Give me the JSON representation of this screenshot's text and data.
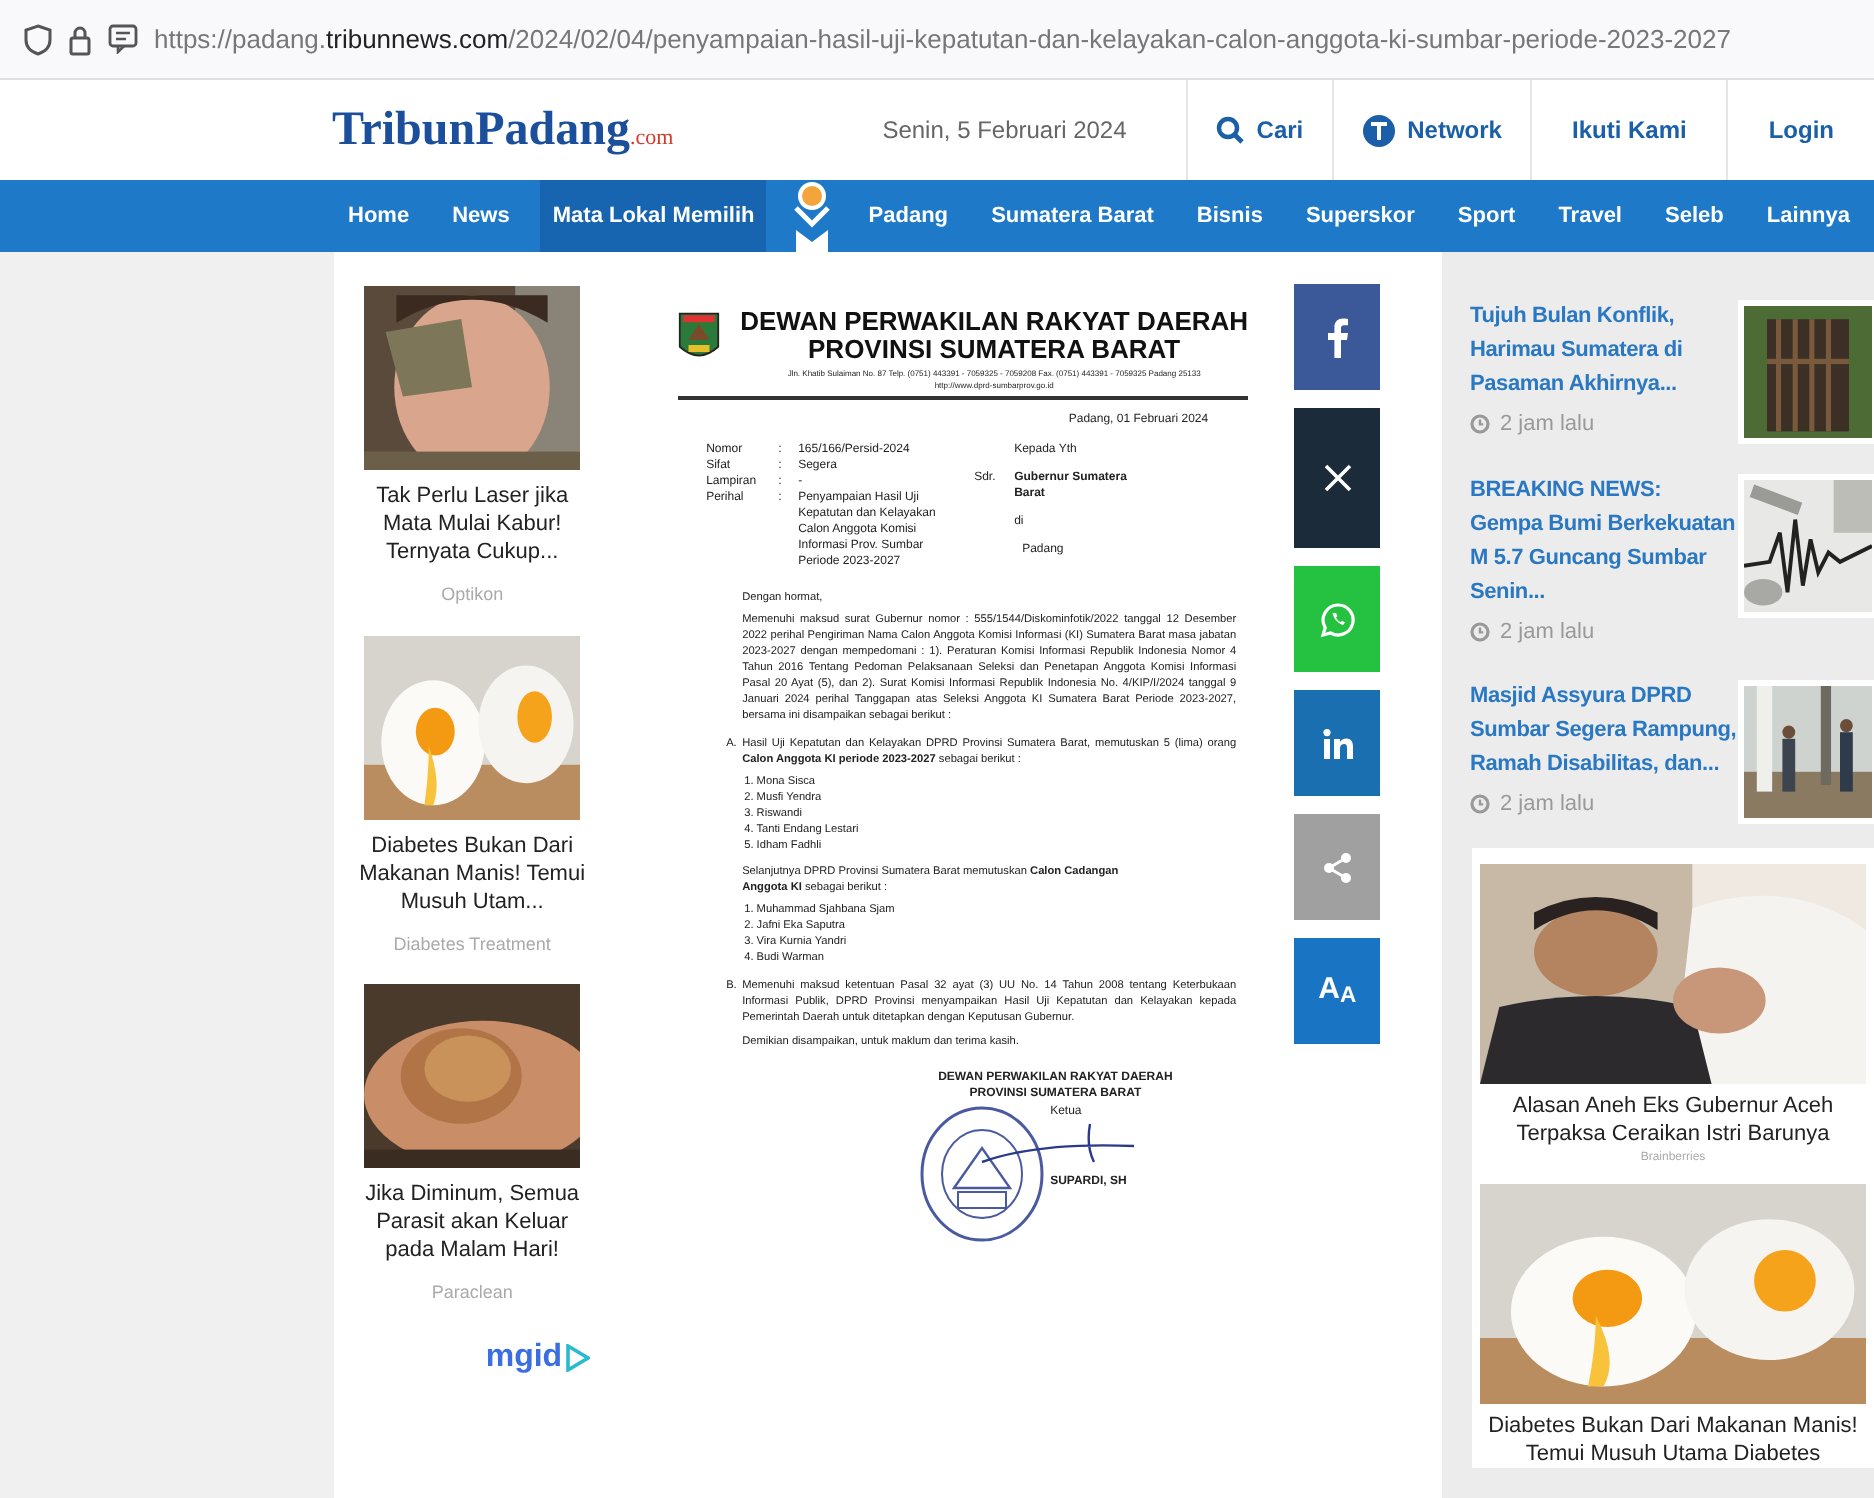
{
  "browser": {
    "url": "https://padang.**tribunnews.com**/2024/02/04/penyampaian-hasil-uji-kepatutan-dan-kelayakan-calon-anggota-ki-sumbar-periode-2023-2027"
  },
  "header": {
    "logo": "TribunPadang",
    "logo_suffix": ".com",
    "date": "Senin, 5 Februari 2024",
    "links": [
      {
        "kind": "search",
        "label": "Cari"
      },
      {
        "kind": "network",
        "label": "Network"
      },
      {
        "kind": "plain",
        "label": "Ikuti Kami"
      },
      {
        "kind": "plain",
        "label": "Login"
      }
    ]
  },
  "nav": [
    {
      "kind": "link",
      "label": "Home",
      "highlighted": false
    },
    {
      "kind": "link",
      "label": "News",
      "highlighted": false
    },
    {
      "kind": "link",
      "label": "Mata Lokal Memilih",
      "highlighted": true
    },
    {
      "kind": "emblem"
    },
    {
      "kind": "link",
      "label": "Padang",
      "highlighted": false
    },
    {
      "kind": "link",
      "label": "Sumatera Barat",
      "highlighted": false
    },
    {
      "kind": "link",
      "label": "Bisnis",
      "highlighted": false
    },
    {
      "kind": "link",
      "label": "Superskor",
      "highlighted": false
    },
    {
      "kind": "link",
      "label": "Sport",
      "highlighted": false
    },
    {
      "kind": "link",
      "label": "Travel",
      "highlighted": false
    },
    {
      "kind": "link",
      "label": "Seleb",
      "highlighted": false
    },
    {
      "kind": "link",
      "label": "Lainnya",
      "highlighted": false
    }
  ],
  "left_ads": {
    "items": [
      {
        "title": "Tak Perlu Laser jika Mata Mulai Kabur! Ternyata Cukup...",
        "source": "Optikon"
      },
      {
        "title": "Diabetes Bukan Dari Makanan Manis! Temui Musuh Utam...",
        "source": "Diabetes Treatment"
      },
      {
        "title": "Jika Diminum, Semua Parasit akan Keluar pada Malam Hari!",
        "source": "Paraclean"
      }
    ],
    "brand": "mgid"
  },
  "letter": {
    "org_line1": "DEWAN PERWAKILAN RAKYAT DAERAH",
    "org_line2": "PROVINSI SUMATERA BARAT",
    "address": "Jln. Khatib Sulaiman No. 87 Telp. (0751) 443391 - 7059325 - 7059208 Fax. (0751) 443391 - 7059325 Padang 25133",
    "website": "http://www.dprd-sumbarprov.go.id",
    "date": "Padang, 01 Februari 2024",
    "meta": [
      {
        "label": "Nomor",
        "separator": ":",
        "value": "165/166/Persid-2024"
      },
      {
        "label": "Sifat",
        "separator": ":",
        "value": "Segera"
      },
      {
        "label": "Lampiran",
        "separator": ":",
        "value": "-"
      },
      {
        "label": "Perihal",
        "separator": ":",
        "value": "Penyampaian Hasil Uji Kepatutan dan Kelayakan Calon Anggota Komisi Informasi Prov. Sumbar Periode 2023-2027"
      }
    ],
    "recipient": {
      "greeting": "Kepada Yth",
      "prefix": "Sdr.",
      "name": "Gubernur Sumatera Barat",
      "at": "di",
      "place": "Padang"
    },
    "salutation": "Dengan hormat,",
    "intro": "Memenuhi maksud surat Gubernur nomor : 555/1544/Diskominfotik/2022 tanggal 12 Desember 2022 perihal Pengiriman Nama Calon Anggota Komisi Informasi (KI) Sumatera Barat masa jabatan 2023-2027 dengan mempedomani : 1). Peraturan Komisi Informasi Republik Indonesia Nomor 4 Tahun 2016 Tentang Pedoman Pelaksanaan Seleksi dan Penetapan Anggota Komisi Informasi Pasal 20 Ayat (5), dan 2). Surat Komisi Informasi Republik Indonesia No. 4/KIP/I/2024 tanggal 9 Januari 2024 perihal Tanggapan atas Seleksi Anggota KI Sumatera Barat Periode 2023-2027, bersama ini disampaikan sebagai berikut :",
    "point_a": {
      "marker": "A.",
      "text": "Hasil Uji Kepatutan dan Kelayakan DPRD Provinsi Sumatera Barat, memutuskan 5 (lima) orang **Calon Anggota KI periode 2023-2027** sebagai berikut :",
      "members": [
        "1. Mona Sisca",
        "2. Musfi Yendra",
        "3. Riswandi",
        "4. Tanti Endang Lestari",
        "5. Idham Fadhli"
      ],
      "reserve_text": "Selanjutnya DPRD Provinsi Sumatera Barat memutuskan **Calon Cadangan Anggota KI** sebagai berikut :",
      "reserves": [
        "1. Muhammad Sjahbana Sjam",
        "2. Jafni Eka Saputra",
        "3. Vira Kurnia Yandri",
        "4. Budi Warman"
      ]
    },
    "point_b": {
      "marker": "B.",
      "text": "Memenuhi maksud  ketentuan Pasal 32 ayat (3) UU No. 14 Tahun 2008 tentang Keterbukaan Informasi Publik, DPRD Provinsi menyampaikan Hasil Uji Kepatutan dan Kelayakan kepada Pemerintah Daerah untuk ditetapkan dengan Keputusan Gubernur."
    },
    "closing": "Demikian disampaikan, untuk maklum dan terima kasih.",
    "signature": {
      "line1": "DEWAN PERWAKILAN RAKYAT DAERAH",
      "line2": "PROVINSI SUMATERA BARAT",
      "role": "Ketua",
      "name": "SUPARDI, SH"
    }
  },
  "share_buttons": [
    {
      "kind": "facebook",
      "color": "#3b5998"
    },
    {
      "kind": "x",
      "color": "#1c2b39"
    },
    {
      "kind": "whatsapp",
      "color": "#25c241"
    },
    {
      "kind": "linkedin",
      "color": "#1a6fb0"
    },
    {
      "kind": "share",
      "color": "#a0a0a0"
    },
    {
      "kind": "font_size",
      "color": "#1a74c4",
      "label": "A$_{A}$"
    }
  ],
  "right_news": [
    {
      "title": "Tujuh Bulan Konflik, Harimau Sumatera di Pasaman Akhirnya...",
      "time": "2 jam lalu"
    },
    {
      "title": "BREAKING NEWS: Gempa Bumi Berkekuatan M 5.7 Guncang Sumbar Senin...",
      "time": "2 jam lalu"
    },
    {
      "title": "Masjid Assyura DPRD Sumbar Segera Rampung, Ramah Disabilitas, dan...",
      "time": "2 jam lalu"
    }
  ],
  "right_ads": [
    {
      "title": "Alasan Aneh Eks Gubernur Aceh Terpaksa Ceraikan Istri Barunya",
      "source": "Brainberries"
    },
    {
      "title": "Diabetes Bukan Dari Makanan Manis! Temui Musuh Utama Diabetes"
    }
  ]
}
